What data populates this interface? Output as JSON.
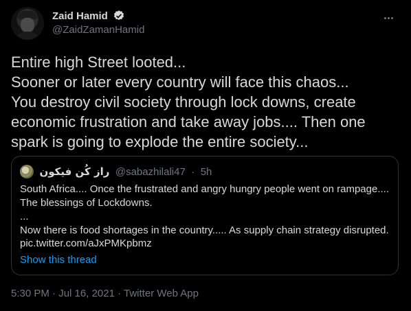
{
  "author": {
    "display_name": "Zaid Hamid",
    "handle": "@ZaidZamanHamid",
    "verified_icon": "verified-badge-icon"
  },
  "tweet": {
    "text": "Entire high Street looted...\nSooner or later every country will face this chaos...\nYou destroy civil society through lock downs, create economic frustration and take away jobs.... Then one spark is going to explode the entire society..."
  },
  "quoted_tweet": {
    "display_name": "راز کُن فیکون",
    "handle": "@sabazhilali47",
    "separator": "·",
    "time": "5h",
    "text": "South Africa.... Once the frustrated and angry hungry people went on rampage....\nThe blessings of Lockdowns.\n...\nNow there is food shortages in the country..... As supply chain strategy disrupted.",
    "link": "pic.twitter.com/aJxPMKpbmz",
    "show_thread": "Show this thread"
  },
  "footer": {
    "time": "5:30 PM",
    "date": "Jul 16, 2021",
    "source": "Twitter Web App",
    "separator": " · "
  },
  "colors": {
    "background": "#000000",
    "text": "#d9d9d9",
    "muted": "#6e767d",
    "accent": "#1d9bf0"
  }
}
